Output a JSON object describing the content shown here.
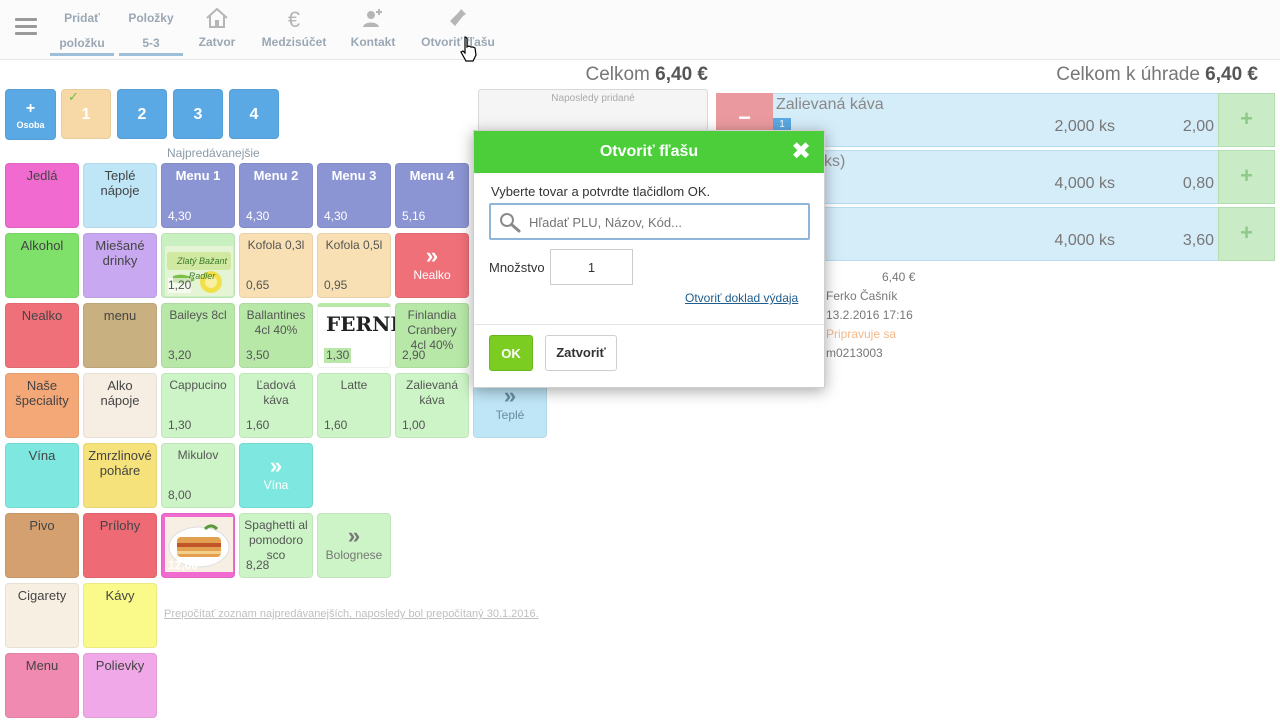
{
  "toolbar": {
    "items": [
      {
        "line1": "Pridať",
        "line2": "položku"
      },
      {
        "line1": "Položky",
        "line2": "5-3"
      },
      {
        "icon": "house-icon",
        "label": "Zatvor"
      },
      {
        "icon": "euro-icon",
        "label": "Medzisúčet"
      },
      {
        "icon": "add-contact-icon",
        "label": "Kontakt"
      },
      {
        "icon": "bottle-icon",
        "label": "Otvoriť fľašu"
      }
    ]
  },
  "totals": {
    "left_label": "Celkom",
    "left_value": "6,40 €",
    "right_label": "Celkom k úhrade",
    "right_value": "6,40 €"
  },
  "seats": {
    "osoba_plus": "+",
    "osoba_label": "Osoba",
    "checkmark": "✓",
    "seat1": "1",
    "seat2": "2",
    "seat3": "3",
    "seat4": "4"
  },
  "bestseller_label": "Najpredávanejšie",
  "categories": {
    "c1": "Jedlá",
    "c2": "Teplé nápoje",
    "c3": "Alkohol",
    "c4": "Miešané drinky",
    "c5": "Nealko",
    "c6": "menu",
    "c7": "Naše špeciality",
    "c8": "Alko nápoje",
    "c9": "Vína",
    "c10": "Zmrzlinové poháre",
    "c11": "Pivo",
    "c12": "Prílohy",
    "c13": "Cigarety",
    "c14": "Kávy",
    "c15": "Menu",
    "c16": "Polievky"
  },
  "menus": {
    "m1": {
      "name": "Menu 1",
      "price": "4,30"
    },
    "m2": {
      "name": "Menu 2",
      "price": "4,30"
    },
    "m3": {
      "name": "Menu 3",
      "price": "4,30"
    },
    "m4": {
      "name": "Menu 4",
      "price": "5,16"
    }
  },
  "products": {
    "radler": {
      "price": "1,20",
      "brand": "Zlatý Bažant Radler"
    },
    "kofola03": {
      "name": "Kofola 0,3l",
      "price": "0,65"
    },
    "kofola05": {
      "name": "Kofola 0,5l",
      "price": "0,95"
    },
    "nealko_more": {
      "label": "Nealko"
    },
    "baileys": {
      "name": "Baileys 8cl",
      "price": "3,20"
    },
    "ballantines": {
      "name": "Ballantines 4cl 40%",
      "price": "3,50"
    },
    "fernet": {
      "price": "1,30",
      "brand": "FERNET"
    },
    "finlandia": {
      "name": "Finlandia Cranbery 4cl 40%",
      "price": "2,90"
    },
    "cappucino": {
      "name": "Cappucino",
      "price": "1,30"
    },
    "ladova": {
      "name": "Ľadová káva",
      "price": "1,60"
    },
    "latte": {
      "name": "Latte",
      "price": "1,60"
    },
    "zalievana": {
      "name": "Zalievaná káva",
      "price": "1,00"
    },
    "teple_more": {
      "label": "Teplé"
    },
    "mikulov": {
      "name": "Mikulov",
      "price": "8,00"
    },
    "vina_more": {
      "label": "Vína"
    },
    "lasagne": {
      "price": "12,00"
    },
    "spaghetti": {
      "name": "Spaghetti al pomodoro sco",
      "price": "8,28"
    },
    "bolognese_more": {
      "label": "Bolognese"
    }
  },
  "more_arrow": "»",
  "recalc_link": "Prepočítať zoznam najpredávanejších, naposledy bol prepočítaný 30.1.2016.",
  "recently_added": "Naposledy pridané",
  "order": {
    "minus": "−",
    "plus": "+",
    "seat_badge": "1",
    "rows": [
      {
        "name": "Zalievaná káva",
        "qty": "2,000 ks",
        "price": "2,00"
      },
      {
        "name": "ks)",
        "qty": "4,000 ks",
        "price": "0,80"
      },
      {
        "name": "",
        "qty": "4,000 ks",
        "price": "3,60"
      }
    ],
    "info": {
      "total": "6,40 €",
      "waiter": "Ferko Čašník",
      "datetime": "13.2.2016 17:16",
      "status": "Pripravuje sa",
      "code": "m0213003"
    }
  },
  "modal": {
    "title": "Otvoriť fľašu",
    "close_icon": "✖",
    "instruction": "Vyberte tovar a potvrdte tlačidlom OK.",
    "search_placeholder": "Hľadať PLU, Názov, Kód...",
    "qty_label": "Množstvo",
    "qty_value": "1",
    "link": "Otvoriť doklad výdaja",
    "ok_label": "OK",
    "close_label": "Zatvoriť"
  },
  "colors": {
    "modal_header": "#4bce3a",
    "ok_button": "#7ccd22",
    "seat_blue": "#5aa9e4",
    "menu_purple": "#8c95d3"
  }
}
